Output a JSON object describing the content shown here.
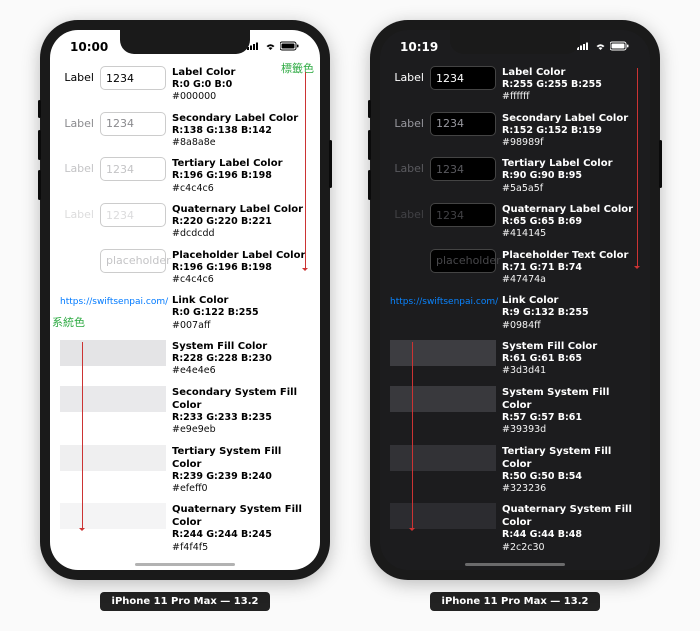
{
  "devices": [
    {
      "mode": "light",
      "time": "10:00"
    },
    {
      "mode": "dark",
      "time": "10:19"
    }
  ],
  "caption": "iPhone 11 Pro Max — 13.2",
  "rows": {
    "label": "Label",
    "placeholder_text": "placeholder",
    "value_sample": "1234",
    "annot_label_color": "標籤色",
    "annot_system_color": "系統色",
    "link_url": "https://swiftsenpai.com/"
  },
  "light": {
    "label": {
      "title": "Label Color",
      "rgb": "R:0 G:0 B:0",
      "hex": "#000000",
      "css": "#000000"
    },
    "secondary": {
      "title": "Secondary Label Color",
      "rgb": "R:138 G:138 B:142",
      "hex": "#8a8a8e",
      "css": "#8a8a8e"
    },
    "tertiary": {
      "title": "Tertiary Label Color",
      "rgb": "R:196 G:196 B:198",
      "hex": "#c4c4c6",
      "css": "#c4c4c6"
    },
    "quaternary": {
      "title": "Quaternary Label Color",
      "rgb": "R:220 G:220 B:221",
      "hex": "#dcdcdd",
      "css": "#dcdcdd"
    },
    "placeholder": {
      "title": "Placeholder Label Color",
      "rgb": "R:196 G:196 B:198",
      "hex": "#c4c4c6",
      "css": "#c4c4c6"
    },
    "link": {
      "title": "Link Color",
      "rgb": "R:0 G:122 B:255",
      "hex": "#007aff",
      "css": "#007aff"
    },
    "fill1": {
      "title": "System Fill Color",
      "rgb": "R:228 G:228 B:230",
      "hex": "#e4e4e6",
      "css": "#e4e4e6"
    },
    "fill2": {
      "title": "Secondary System Fill Color",
      "rgb": "R:233 G:233 B:235",
      "hex": "#e9e9eb",
      "css": "#e9e9eb"
    },
    "fill3": {
      "title": "Tertiary System Fill Color",
      "rgb": "R:239 G:239 B:240",
      "hex": "#efeff0",
      "css": "#efeff0"
    },
    "fill4": {
      "title": "Quaternary System Fill Color",
      "rgb": "R:244 G:244 B:245",
      "hex": "#f4f4f5",
      "css": "#f4f4f5"
    }
  },
  "dark": {
    "label": {
      "title": "Label Color",
      "rgb": "R:255 G:255 B:255",
      "hex": "#ffffff",
      "css": "#ffffff"
    },
    "secondary": {
      "title": "Secondary Label Color",
      "rgb": "R:152 G:152 B:159",
      "hex": "#98989f",
      "css": "#98989f"
    },
    "tertiary": {
      "title": "Tertiary Label Color",
      "rgb": "R:90 G:90 B:95",
      "hex": "#5a5a5f",
      "css": "#5a5a5f"
    },
    "quaternary": {
      "title": "Quaternary Label Color",
      "rgb": "R:65 G:65 B:69",
      "hex": "#414145",
      "css": "#414145"
    },
    "placeholder": {
      "title": "Placeholder Text Color",
      "rgb": "R:71 G:71 B:74",
      "hex": "#47474a",
      "css": "#47474a"
    },
    "link": {
      "title": "Link Color",
      "rgb": "R:9 G:132 B:255",
      "hex": "#0984ff",
      "css": "#0984ff"
    },
    "fill1": {
      "title": "System Fill Color",
      "rgb": "R:61 G:61 B:65",
      "hex": "#3d3d41",
      "css": "#3d3d41"
    },
    "fill2": {
      "title": "System System Fill Color",
      "rgb": "R:57 G:57 B:61",
      "hex": "#39393d",
      "css": "#39393d"
    },
    "fill3": {
      "title": "Tertiary System Fill Color",
      "rgb": "R:50 G:50 B:54",
      "hex": "#323236",
      "css": "#323236"
    },
    "fill4": {
      "title": "Quaternary System Fill Color",
      "rgb": "R:44 G:44 B:48",
      "hex": "#2c2c30",
      "css": "#2c2c30"
    }
  }
}
